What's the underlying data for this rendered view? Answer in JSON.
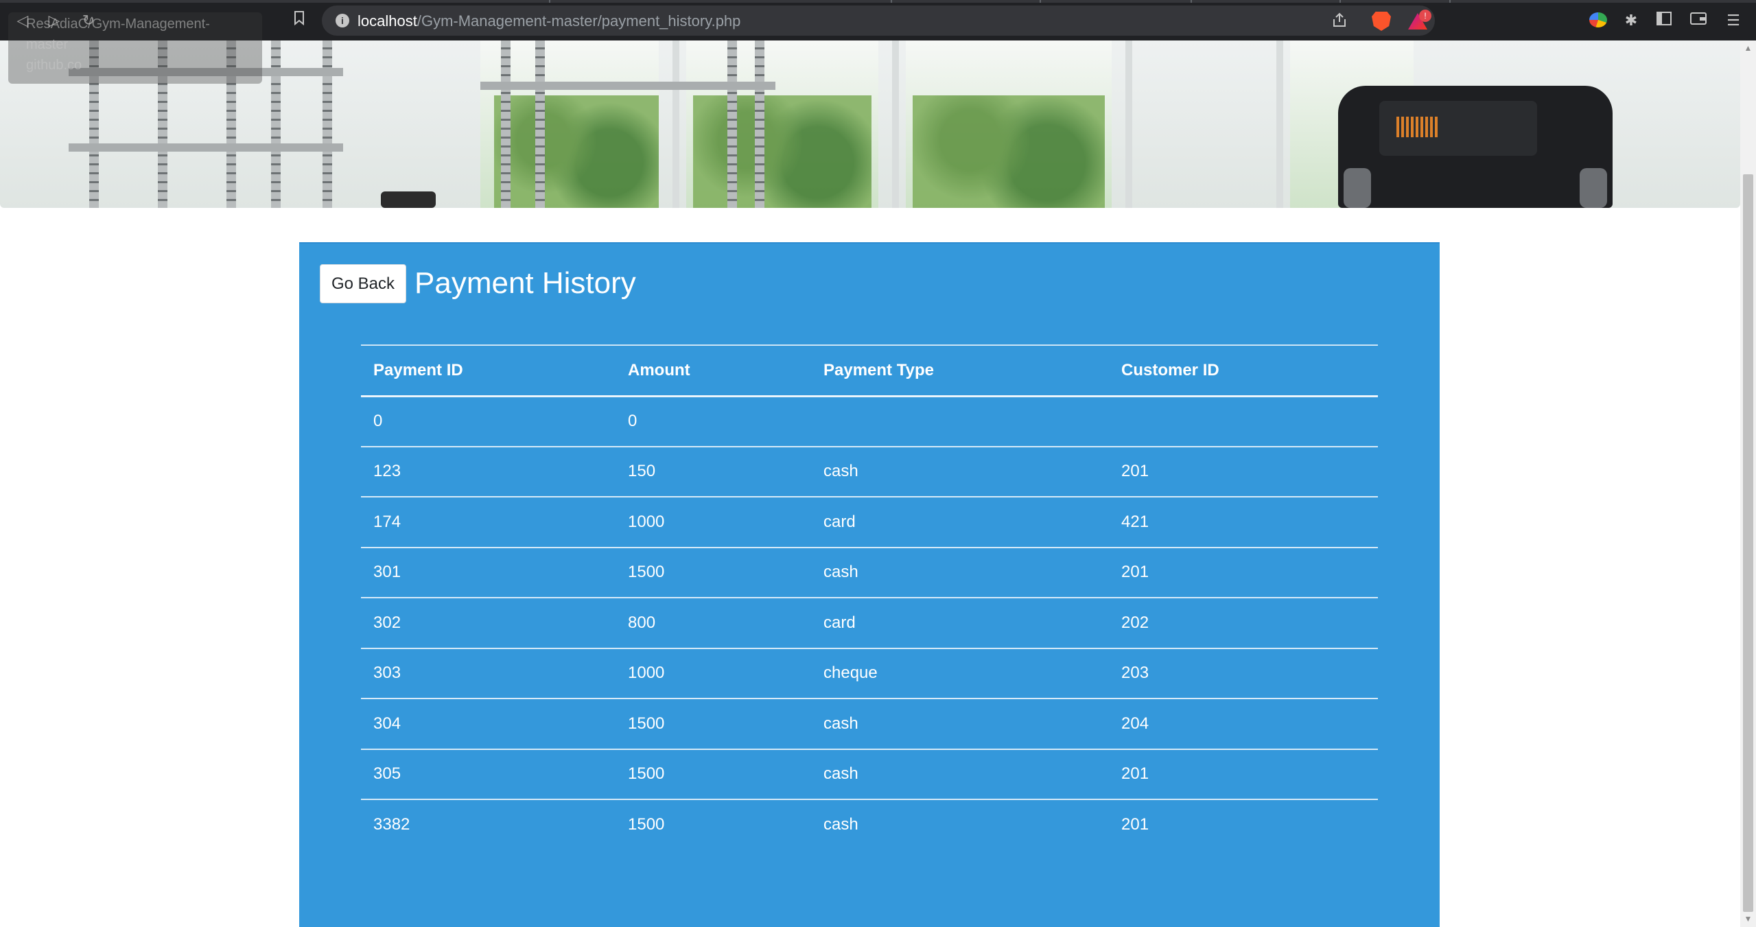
{
  "browser": {
    "url_host": "localhost",
    "url_path": "/Gym-Management-master/payment_history.php",
    "tooltip_lines": [
      "ResAdiaC/Gym-Management-",
      "master",
      "github.co"
    ],
    "rewards_badge": "!"
  },
  "page": {
    "go_back_label": "Go Back",
    "title": "Payment History"
  },
  "table": {
    "headers": [
      "Payment ID",
      "Amount",
      "Payment Type",
      "Customer ID"
    ],
    "rows": [
      [
        "0",
        "0",
        "",
        ""
      ],
      [
        "123",
        "150",
        "cash",
        "201"
      ],
      [
        "174",
        "1000",
        "card",
        "421"
      ],
      [
        "301",
        "1500",
        "cash",
        "201"
      ],
      [
        "302",
        "800",
        "card",
        "202"
      ],
      [
        "303",
        "1000",
        "cheque",
        "203"
      ],
      [
        "304",
        "1500",
        "cash",
        "204"
      ],
      [
        "305",
        "1500",
        "cash",
        "201"
      ],
      [
        "3382",
        "1500",
        "cash",
        "201"
      ]
    ]
  },
  "colors": {
    "panel": "#3498db",
    "browser_bg": "#202124"
  }
}
